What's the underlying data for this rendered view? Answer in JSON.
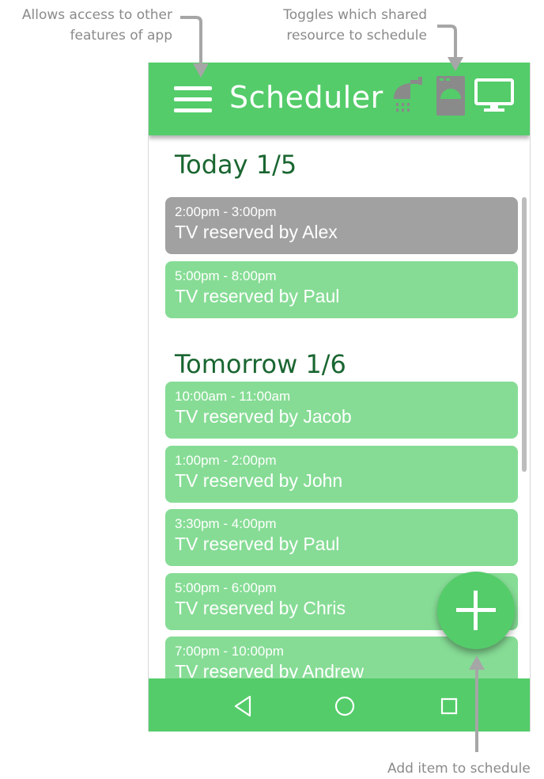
{
  "annotations": {
    "menu_note_line1": "Allows access to other",
    "menu_note_line2": "features of app",
    "toggle_note_line1": "Toggles which shared",
    "toggle_note_line2": "resource to schedule",
    "fab_note": "Add item to schedule"
  },
  "appbar": {
    "title": "Scheduler",
    "resources": [
      "shower-icon",
      "washing-machine-icon",
      "tv-icon"
    ],
    "selected_resource": "tv-icon"
  },
  "schedule": {
    "today": {
      "heading": "Today 1/5",
      "items": [
        {
          "time": "2:00pm - 3:00pm",
          "label": "TV reserved by Alex",
          "state": "past"
        },
        {
          "time": "5:00pm - 8:00pm",
          "label": "TV reserved by Paul",
          "state": "upcoming"
        }
      ]
    },
    "tomorrow": {
      "heading": "Tomorrow 1/6",
      "items": [
        {
          "time": "10:00am - 11:00am",
          "label": "TV reserved by Jacob",
          "state": "upcoming"
        },
        {
          "time": "1:00pm - 2:00pm",
          "label": "TV reserved by John",
          "state": "upcoming"
        },
        {
          "time": "3:30pm - 4:00pm",
          "label": "TV reserved by Paul",
          "state": "upcoming"
        },
        {
          "time": "5:00pm - 6:00pm",
          "label": "TV reserved by Chris",
          "state": "upcoming"
        },
        {
          "time": "7:00pm - 10:00pm",
          "label": "TV reserved by Andrew",
          "state": "upcoming"
        }
      ]
    }
  },
  "nav": [
    "back-icon",
    "home-icon",
    "recents-icon"
  ],
  "colors": {
    "primary": "#54cc6a",
    "card_upcoming": "#86dc95",
    "card_past": "#a1a1a1",
    "heading": "#1a6631",
    "annotation": "#8a8a8a"
  }
}
